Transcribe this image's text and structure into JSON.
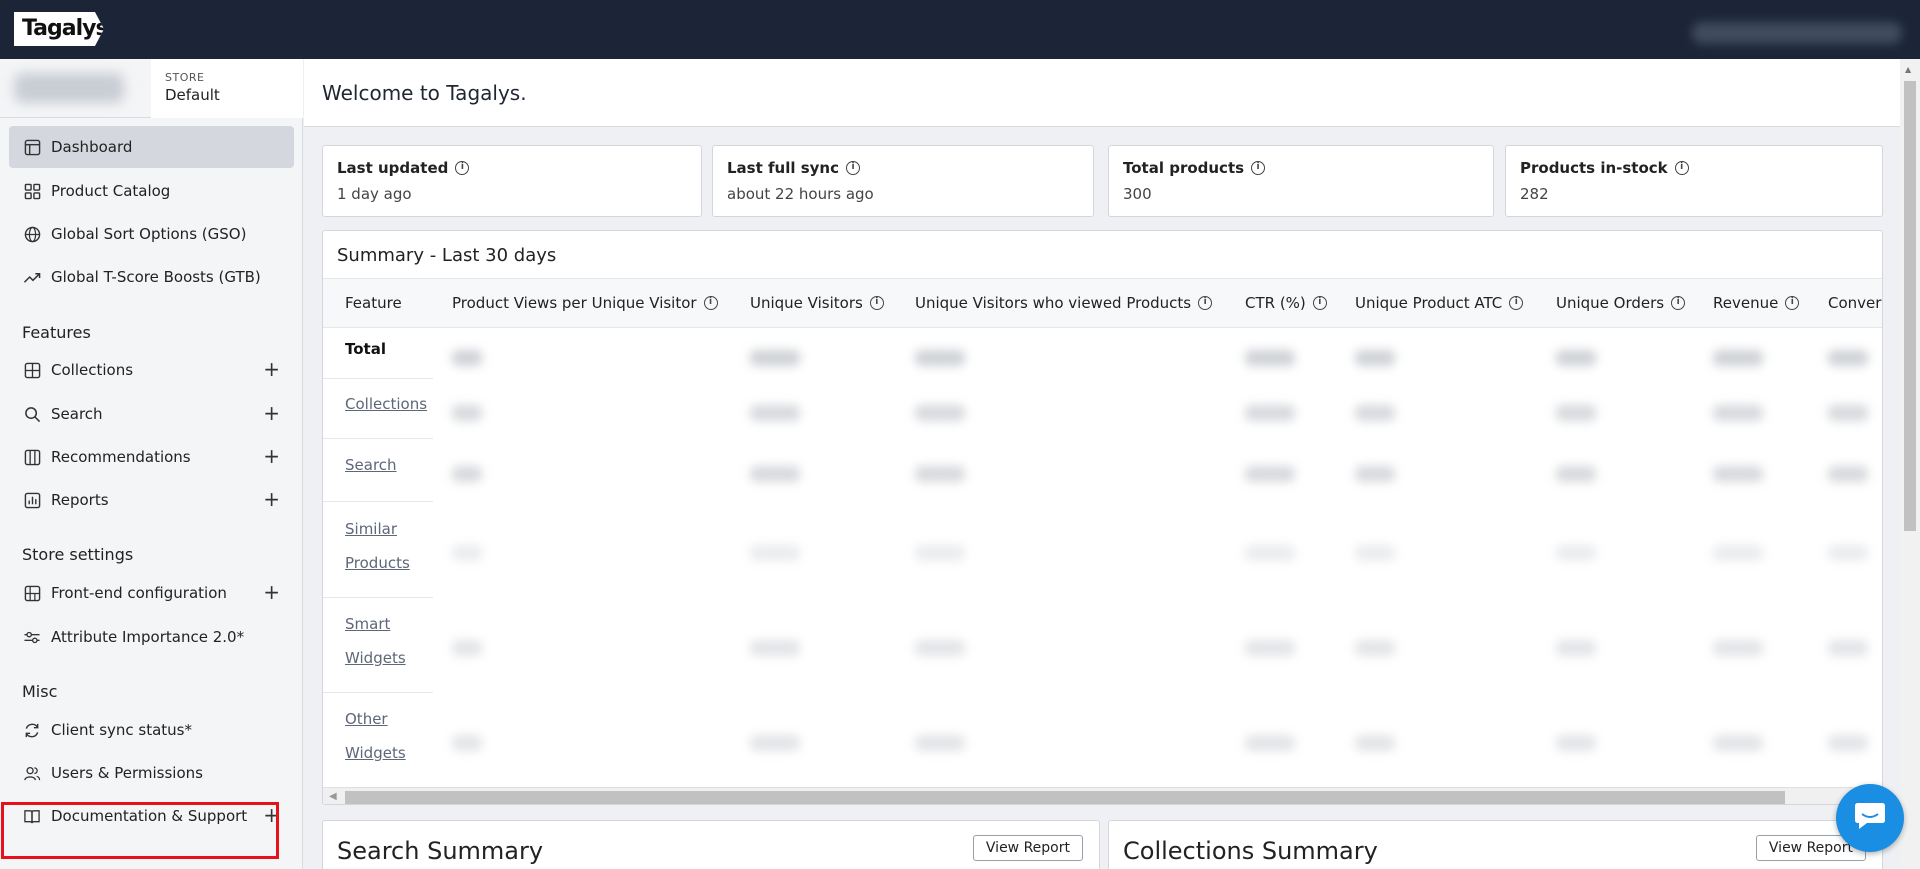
{
  "app": {
    "logo": "Tagalys"
  },
  "sidebar": {
    "store_label": "STORE",
    "store_value": "Default",
    "top_items": [
      {
        "label": "Dashboard",
        "icon": "layout-icon",
        "active": true
      },
      {
        "label": "Product Catalog",
        "icon": "grid-icon"
      },
      {
        "label": "Global Sort Options (GSO)",
        "icon": "globe-icon"
      },
      {
        "label": "Global T-Score Boosts (GTB)",
        "icon": "trending-icon"
      }
    ],
    "features_heading": "Features",
    "features": [
      {
        "label": "Collections",
        "icon": "collections-icon"
      },
      {
        "label": "Search",
        "icon": "search-icon"
      },
      {
        "label": "Recommendations",
        "icon": "columns-icon"
      },
      {
        "label": "Reports",
        "icon": "chart-icon"
      }
    ],
    "store_settings_heading": "Store settings",
    "store_settings": [
      {
        "label": "Front-end configuration",
        "icon": "map-icon"
      },
      {
        "label": "Attribute Importance 2.0*",
        "icon": "sliders-icon"
      }
    ],
    "misc_heading": "Misc",
    "misc": [
      {
        "label": "Client sync status*",
        "icon": "sync-icon"
      },
      {
        "label": "Users & Permissions",
        "icon": "users-icon"
      },
      {
        "label": "Documentation & Support",
        "icon": "book-icon"
      }
    ],
    "plus": "+"
  },
  "main": {
    "welcome": "Welcome to Tagalys.",
    "stats": [
      {
        "title": "Last updated",
        "value": "1 day ago"
      },
      {
        "title": "Last full sync",
        "value": "about 22 hours ago"
      },
      {
        "title": "Total products",
        "value": "300"
      },
      {
        "title": "Products in-stock",
        "value": "282"
      }
    ],
    "summary": {
      "title": "Summary - Last 30 days",
      "columns": [
        "Feature",
        "Product Views per Unique Visitor",
        "Unique Visitors",
        "Unique Visitors who viewed Products",
        "CTR (%)",
        "Unique Product ATC",
        "Unique Orders",
        "Revenue",
        "Conver"
      ],
      "rows": [
        {
          "label": "Total",
          "line2": ""
        },
        {
          "label": "Collections",
          "line2": ""
        },
        {
          "label": "Search",
          "line2": ""
        },
        {
          "label": "Similar",
          "line2": "Products"
        },
        {
          "label": "Smart",
          "line2": "Widgets"
        },
        {
          "label": "Other",
          "line2": "Widgets"
        }
      ]
    },
    "search_summary": {
      "title": "Search Summary",
      "button": "View Report"
    },
    "collections_summary": {
      "title": "Collections Summary",
      "button": "View Report"
    }
  },
  "colors": {
    "topbar": "#1b2537",
    "highlight": "#e5121b",
    "chat": "#1a8ee3"
  }
}
